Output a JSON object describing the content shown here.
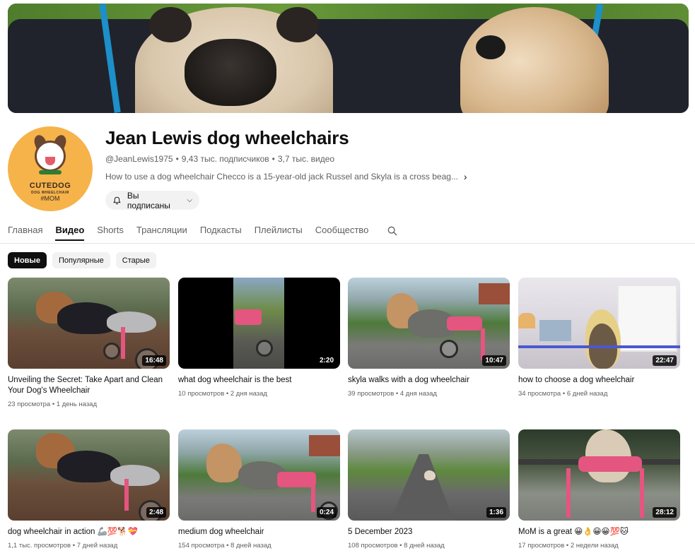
{
  "channel": {
    "name": "Jean Lewis dog wheelchairs",
    "handle": "@JeanLewis1975",
    "subscribers": "9,43 тыс. подписчиков",
    "video_count": "3,7 тыс. видео",
    "description": "How to use a dog wheelchair Checco is a 15-year-old jack Russel and Skyla is a cross beag...",
    "subscribe_label": "Вы подписаны",
    "avatar": {
      "brand": "CUTEDOG",
      "brand_sub": "DOG WHEELCHAIR",
      "tag": "#MOM"
    }
  },
  "tabs": [
    {
      "label": "Главная",
      "active": false
    },
    {
      "label": "Видео",
      "active": true
    },
    {
      "label": "Shorts",
      "active": false
    },
    {
      "label": "Трансляции",
      "active": false
    },
    {
      "label": "Подкасты",
      "active": false
    },
    {
      "label": "Плейлисты",
      "active": false
    },
    {
      "label": "Сообщество",
      "active": false
    }
  ],
  "chips": [
    {
      "label": "Новые",
      "active": true
    },
    {
      "label": "Популярные",
      "active": false
    },
    {
      "label": "Старые",
      "active": false
    }
  ],
  "videos": [
    {
      "title": "Unveiling the Secret: Take Apart and Clean Your Dog's Wheelchair",
      "views": "23 просмотра",
      "age": "1 день назад",
      "duration": "16:48"
    },
    {
      "title": "what dog wheelchair is the best",
      "views": "10 просмотров",
      "age": "2 дня назад",
      "duration": "2:20"
    },
    {
      "title": "skyla walks with a dog wheelchair",
      "views": "39 просмотров",
      "age": "4 дня назад",
      "duration": "10:47"
    },
    {
      "title": "how to choose a dog wheelchair",
      "views": "34 просмотра",
      "age": "6 дней назад",
      "duration": "22:47"
    },
    {
      "title": "dog wheelchair in action 🦾💯🐕💝",
      "views": "1,1 тыс. просмотров",
      "age": "7 дней назад",
      "duration": "2:48"
    },
    {
      "title": "medium dog wheelchair",
      "views": "154 просмотра",
      "age": "8 дней назад",
      "duration": "0:24"
    },
    {
      "title": "5 December 2023",
      "views": "108 просмотров",
      "age": "8 дней назад",
      "duration": "1:36"
    },
    {
      "title": "MoM is a great 😀👌😀😀💯🐱",
      "views": "17 просмотров",
      "age": "2 недели назад",
      "duration": "28:12"
    }
  ],
  "meta_separator": "•",
  "icons": {
    "bell": "bell-icon",
    "caret": "chevron-down-icon",
    "more": "chevron-right-icon",
    "search": "search-icon"
  },
  "colors": {
    "accent": "#0f0f0f",
    "chip_bg": "#f2f2f2",
    "secondary_text": "#606060",
    "avatar_bg": "#f6b34a"
  }
}
